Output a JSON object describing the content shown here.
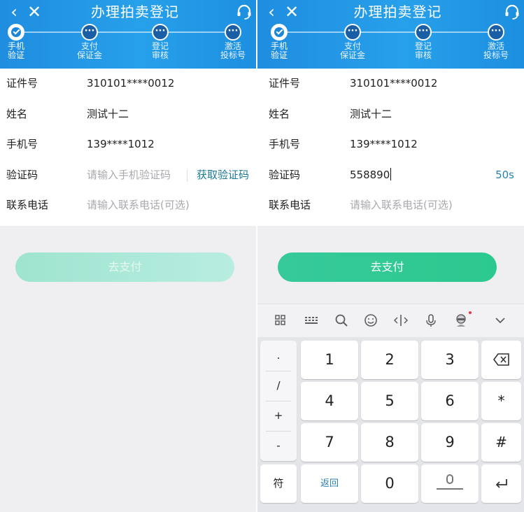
{
  "header": {
    "title": "办理拍卖登记",
    "back_icon": "chevron-left-icon",
    "close_icon": "close-icon",
    "service_icon": "headset-icon",
    "background": "#2196e5"
  },
  "steps": [
    {
      "label": "手机\n验证",
      "state": "done"
    },
    {
      "label": "支付\n保证金",
      "state": "pending"
    },
    {
      "label": "登记\n审核",
      "state": "pending"
    },
    {
      "label": "激活\n投标号",
      "state": "pending"
    }
  ],
  "form": {
    "id_label": "证件号",
    "id_value": "310101****0012",
    "name_label": "姓名",
    "name_value": "测试十二",
    "phone_label": "手机号",
    "phone_value": "139****1012",
    "code_label": "验证码",
    "code_placeholder": "请输入手机验证码",
    "get_code_label": "获取验证码",
    "contact_label": "联系电话",
    "contact_placeholder": "请输入联系电话(可选)"
  },
  "screen_b": {
    "code_value": "558890",
    "countdown": "50s"
  },
  "pay_button": {
    "label": "去支付",
    "disabled_color": "#a7e8d5",
    "enabled_color": "#33c995"
  },
  "keyboard": {
    "toolbar_icons": [
      "grid-icon",
      "keyboard-icon",
      "search-icon",
      "emoji-icon",
      "text-cursor-icon",
      "microphone-icon",
      "avatar-icon",
      "collapse-icon"
    ],
    "symbols": [
      ".",
      "/",
      "+",
      "-"
    ],
    "digits": [
      "1",
      "2",
      "3",
      "4",
      "5",
      "6",
      "7",
      "8",
      "9"
    ],
    "zero": "0",
    "symbol_key": "符",
    "return_key": "返回",
    "star_key": "*",
    "hash_key": "#"
  }
}
